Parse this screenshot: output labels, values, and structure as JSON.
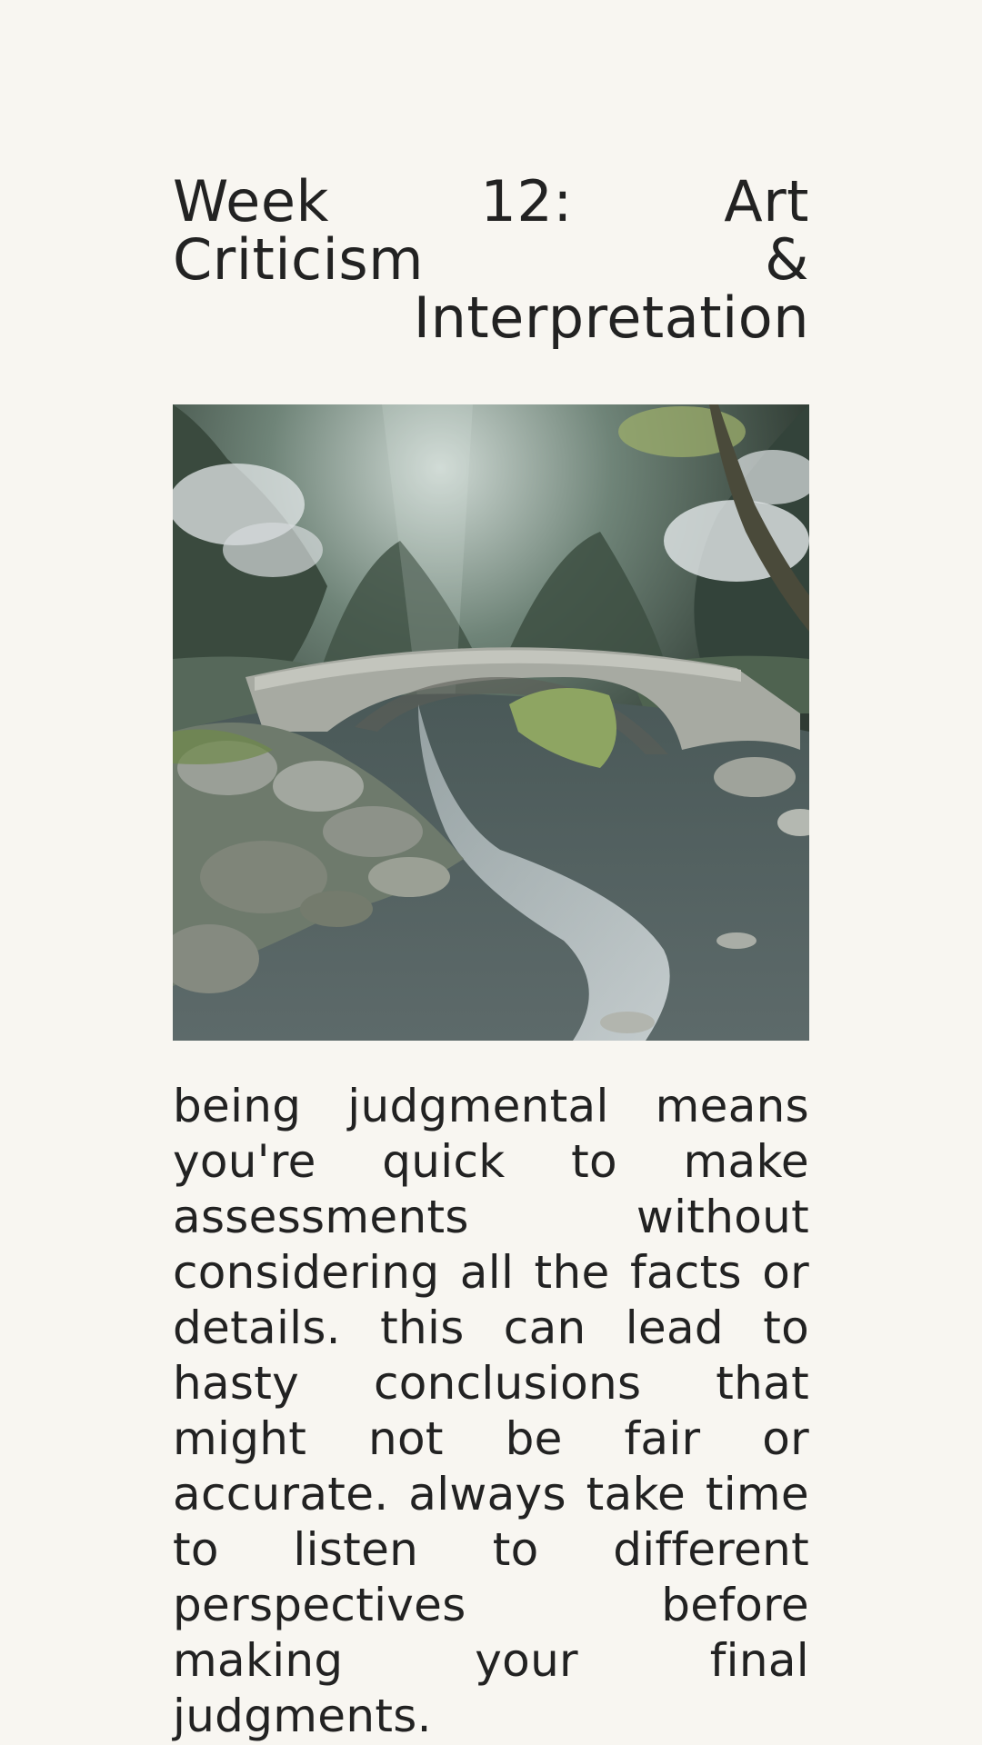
{
  "post": {
    "title": "Week 12: Art Criticism & Interpretation",
    "image": {
      "icon": "landscape-painting-icon",
      "palette": {
        "sky_glow": "#cfd9d4",
        "forest_dark": "#2f3b33",
        "forest_mid": "#4c5e4f",
        "blossom": "#e4e8ea",
        "leaves_light": "#9cad6b",
        "stone": "#a7aaa2",
        "water": "#5d6a6a",
        "water_light": "#d8e0e2"
      }
    },
    "body": "being judgmental means you're quick to make assessments without considering all the facts or details. this can lead to hasty conclusions that might not be fair or accurate. always take time to listen to different perspectives before making your final judgments."
  }
}
